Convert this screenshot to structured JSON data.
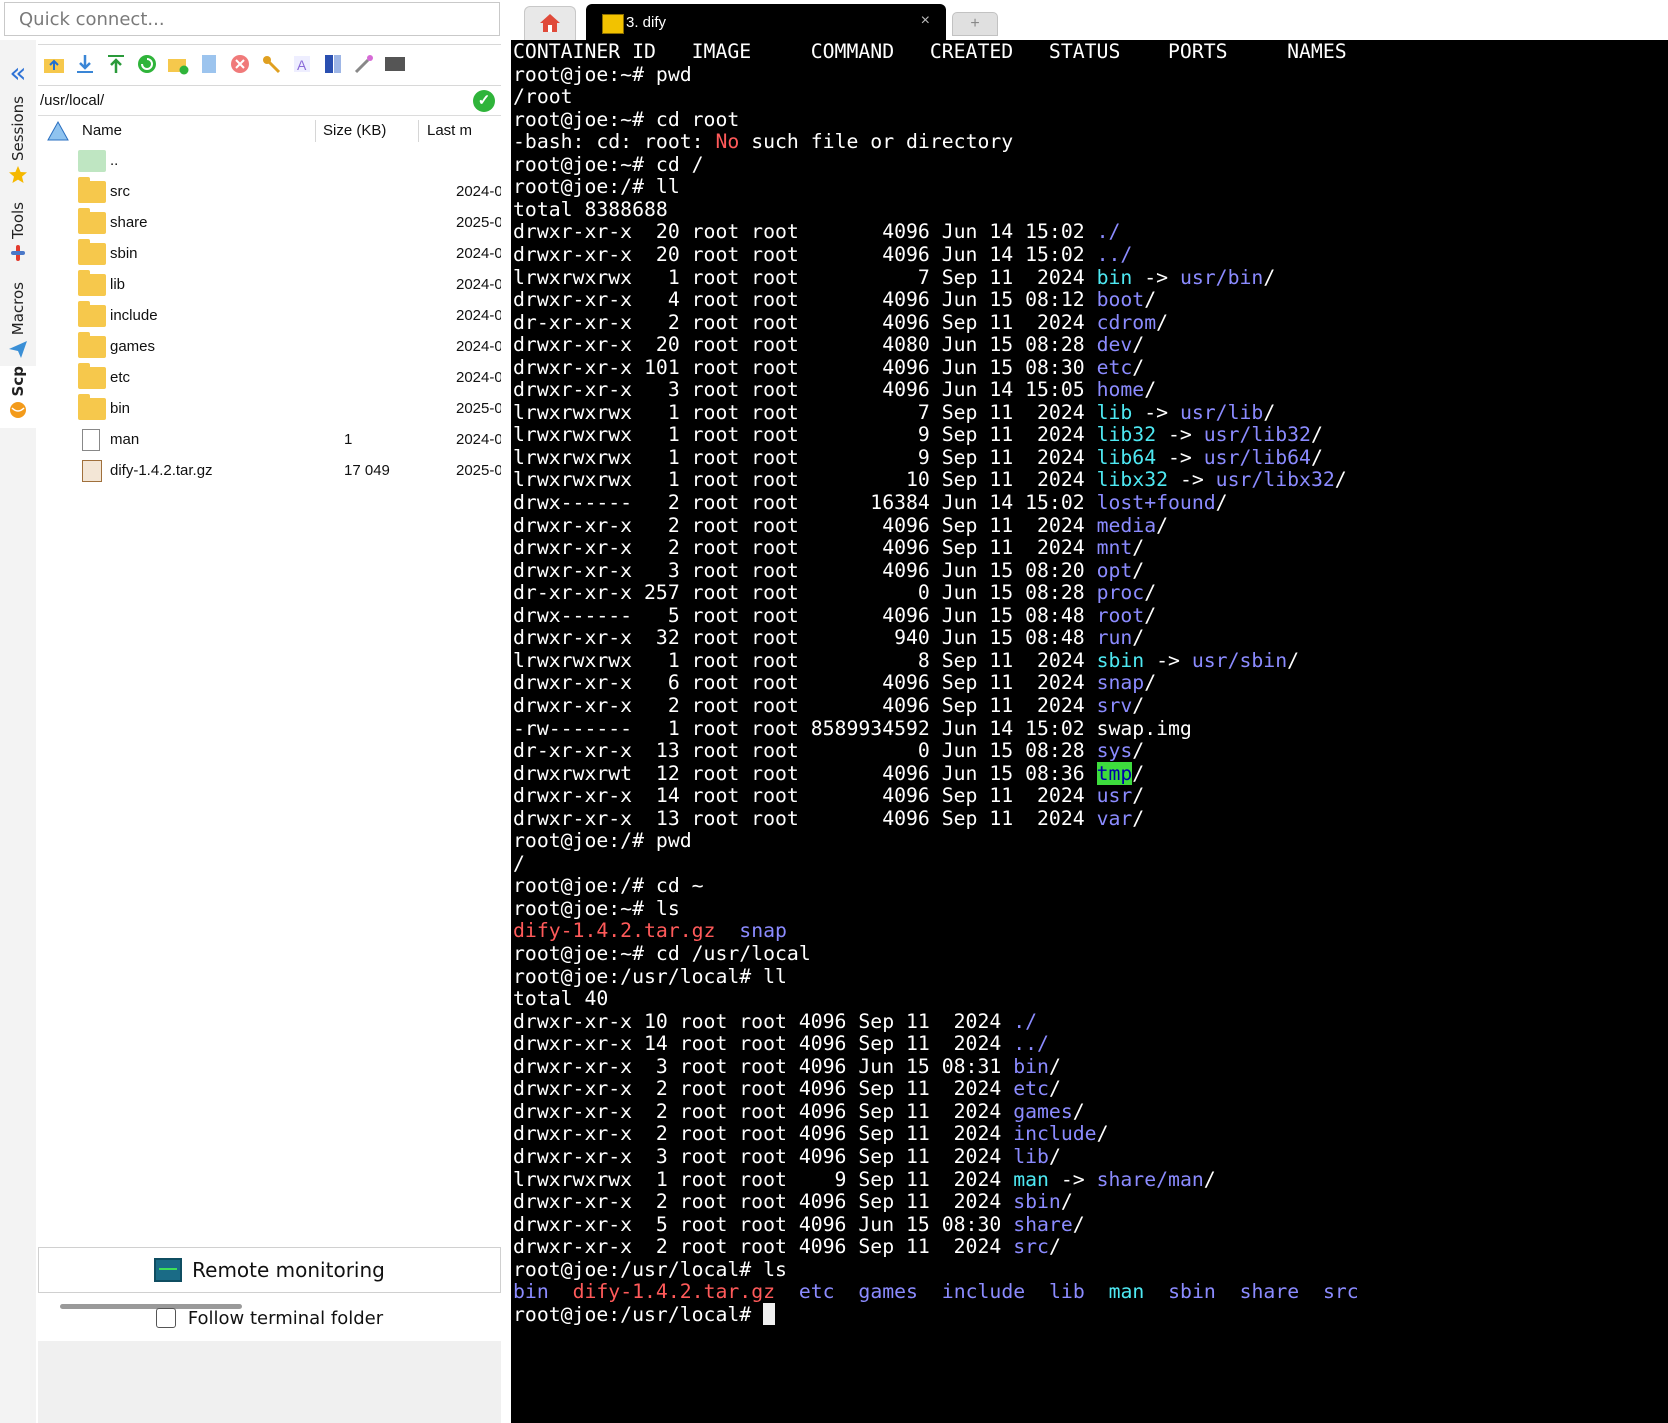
{
  "quick_connect": {
    "placeholder": "Quick connect..."
  },
  "side_tabs": {
    "sessions": "Sessions",
    "tools": "Tools",
    "macros": "Macros",
    "scp": "Scp"
  },
  "browser": {
    "path": "/usr/local/",
    "columns": {
      "name": "Name",
      "size": "Size (KB)",
      "last_modified": "Last m"
    },
    "files": [
      {
        "name": "..",
        "size": "",
        "date": "",
        "kind": "updir"
      },
      {
        "name": "src",
        "size": "",
        "date": "2024-0",
        "kind": "folder"
      },
      {
        "name": "share",
        "size": "",
        "date": "2025-0",
        "kind": "folder"
      },
      {
        "name": "sbin",
        "size": "",
        "date": "2024-0",
        "kind": "folder"
      },
      {
        "name": "lib",
        "size": "",
        "date": "2024-0",
        "kind": "folder"
      },
      {
        "name": "include",
        "size": "",
        "date": "2024-0",
        "kind": "folder"
      },
      {
        "name": "games",
        "size": "",
        "date": "2024-0",
        "kind": "folder"
      },
      {
        "name": "etc",
        "size": "",
        "date": "2024-0",
        "kind": "folder"
      },
      {
        "name": "bin",
        "size": "",
        "date": "2025-0",
        "kind": "folder"
      },
      {
        "name": "man",
        "size": "1",
        "date": "2024-0",
        "kind": "link"
      },
      {
        "name": "dify-1.4.2.tar.gz",
        "size": "17 049",
        "date": "2025-0",
        "kind": "archive"
      }
    ],
    "remote_monitoring": "Remote monitoring",
    "follow_terminal": "Follow terminal folder"
  },
  "tabs": {
    "active_title": "3. dify",
    "close": "×",
    "new": "+"
  },
  "colors": {
    "dir": "#8b8bff",
    "link": "#4ee9f3",
    "error": "#ff5a5a",
    "tmp_bg": "#3ddc3d",
    "folder": "#f6c84c"
  },
  "terminal": {
    "lines": [
      [
        [
          "",
          "CONTAINER ID   IMAGE     COMMAND   CREATED   STATUS    PORTS     NAMES"
        ]
      ],
      [
        [
          "",
          "root@joe:~# pwd"
        ]
      ],
      [
        [
          "",
          "/root"
        ]
      ],
      [
        [
          "",
          "root@joe:~# cd root"
        ]
      ],
      [
        [
          "",
          "-bash: cd: root: "
        ],
        [
          "red",
          "No"
        ],
        [
          "",
          " such file or directory"
        ]
      ],
      [
        [
          "",
          "root@joe:~# cd /"
        ]
      ],
      [
        [
          "",
          "root@joe:/# ll"
        ]
      ],
      [
        [
          "",
          "total 8388688"
        ]
      ],
      [
        [
          "",
          "drwxr-xr-x  20 root root       4096 Jun 14 15:02 "
        ],
        [
          "dir",
          "./"
        ]
      ],
      [
        [
          "",
          "drwxr-xr-x  20 root root       4096 Jun 14 15:02 "
        ],
        [
          "dir",
          "../"
        ]
      ],
      [
        [
          "",
          "lrwxrwxrwx   1 root root          7 Sep 11  2024 "
        ],
        [
          "link",
          "bin"
        ],
        [
          "",
          " -> "
        ],
        [
          "dir",
          "usr/bin"
        ],
        [
          "",
          "/"
        ]
      ],
      [
        [
          "",
          "drwxr-xr-x   4 root root       4096 Jun 15 08:12 "
        ],
        [
          "dir",
          "boot"
        ],
        [
          "",
          "/"
        ]
      ],
      [
        [
          "",
          "dr-xr-xr-x   2 root root       4096 Sep 11  2024 "
        ],
        [
          "dir",
          "cdrom"
        ],
        [
          "",
          "/"
        ]
      ],
      [
        [
          "",
          "drwxr-xr-x  20 root root       4080 Jun 15 08:28 "
        ],
        [
          "dir",
          "dev"
        ],
        [
          "",
          "/"
        ]
      ],
      [
        [
          "",
          "drwxr-xr-x 101 root root       4096 Jun 15 08:30 "
        ],
        [
          "dir",
          "etc"
        ],
        [
          "",
          "/"
        ]
      ],
      [
        [
          "",
          "drwxr-xr-x   3 root root       4096 Jun 14 15:05 "
        ],
        [
          "dir",
          "home"
        ],
        [
          "",
          "/"
        ]
      ],
      [
        [
          "",
          "lrwxrwxrwx   1 root root          7 Sep 11  2024 "
        ],
        [
          "link",
          "lib"
        ],
        [
          "",
          " -> "
        ],
        [
          "dir",
          "usr/lib"
        ],
        [
          "",
          "/"
        ]
      ],
      [
        [
          "",
          "lrwxrwxrwx   1 root root          9 Sep 11  2024 "
        ],
        [
          "link",
          "lib32"
        ],
        [
          "",
          " -> "
        ],
        [
          "dir",
          "usr/lib32"
        ],
        [
          "",
          "/"
        ]
      ],
      [
        [
          "",
          "lrwxrwxrwx   1 root root          9 Sep 11  2024 "
        ],
        [
          "link",
          "lib64"
        ],
        [
          "",
          " -> "
        ],
        [
          "dir",
          "usr/lib64"
        ],
        [
          "",
          "/"
        ]
      ],
      [
        [
          "",
          "lrwxrwxrwx   1 root root         10 Sep 11  2024 "
        ],
        [
          "link",
          "libx32"
        ],
        [
          "",
          " -> "
        ],
        [
          "dir",
          "usr/libx32"
        ],
        [
          "",
          "/"
        ]
      ],
      [
        [
          "",
          "drwx------   2 root root      16384 Jun 14 15:02 "
        ],
        [
          "dir",
          "lost+found"
        ],
        [
          "",
          "/"
        ]
      ],
      [
        [
          "",
          "drwxr-xr-x   2 root root       4096 Sep 11  2024 "
        ],
        [
          "dir",
          "media"
        ],
        [
          "",
          "/"
        ]
      ],
      [
        [
          "",
          "drwxr-xr-x   2 root root       4096 Sep 11  2024 "
        ],
        [
          "dir",
          "mnt"
        ],
        [
          "",
          "/"
        ]
      ],
      [
        [
          "",
          "drwxr-xr-x   3 root root       4096 Jun 15 08:20 "
        ],
        [
          "dir",
          "opt"
        ],
        [
          "",
          "/"
        ]
      ],
      [
        [
          "",
          "dr-xr-xr-x 257 root root          0 Jun 15 08:28 "
        ],
        [
          "dir",
          "proc"
        ],
        [
          "",
          "/"
        ]
      ],
      [
        [
          "",
          "drwx------   5 root root       4096 Jun 15 08:48 "
        ],
        [
          "dir",
          "root"
        ],
        [
          "",
          "/"
        ]
      ],
      [
        [
          "",
          "drwxr-xr-x  32 root root        940 Jun 15 08:48 "
        ],
        [
          "dir",
          "run"
        ],
        [
          "",
          "/"
        ]
      ],
      [
        [
          "",
          "lrwxrwxrwx   1 root root          8 Sep 11  2024 "
        ],
        [
          "link",
          "sbin"
        ],
        [
          "",
          " -> "
        ],
        [
          "dir",
          "usr/sbin"
        ],
        [
          "",
          "/"
        ]
      ],
      [
        [
          "",
          "drwxr-xr-x   6 root root       4096 Sep 11  2024 "
        ],
        [
          "dir",
          "snap"
        ],
        [
          "",
          "/"
        ]
      ],
      [
        [
          "",
          "drwxr-xr-x   2 root root       4096 Sep 11  2024 "
        ],
        [
          "dir",
          "srv"
        ],
        [
          "",
          "/"
        ]
      ],
      [
        [
          "",
          "-rw-------   1 root root 8589934592 Jun 14 15:02 swap.img"
        ]
      ],
      [
        [
          "",
          "dr-xr-xr-x  13 root root          0 Jun 15 08:28 "
        ],
        [
          "dir",
          "sys"
        ],
        [
          "",
          "/"
        ]
      ],
      [
        [
          "",
          "drwxrwxrwt  12 root root       4096 Jun 15 08:36 "
        ],
        [
          "tmp",
          "tmp"
        ],
        [
          "",
          "/"
        ]
      ],
      [
        [
          "",
          "drwxr-xr-x  14 root root       4096 Sep 11  2024 "
        ],
        [
          "dir",
          "usr"
        ],
        [
          "",
          "/"
        ]
      ],
      [
        [
          "",
          "drwxr-xr-x  13 root root       4096 Sep 11  2024 "
        ],
        [
          "dir",
          "var"
        ],
        [
          "",
          "/"
        ]
      ],
      [
        [
          "",
          "root@joe:/# pwd"
        ]
      ],
      [
        [
          "",
          "/"
        ]
      ],
      [
        [
          "",
          "root@joe:/# cd ~"
        ]
      ],
      [
        [
          "",
          "root@joe:~# ls"
        ]
      ],
      [
        [
          "tar",
          "dify-1.4.2.tar.gz"
        ],
        [
          "",
          "  "
        ],
        [
          "dir",
          "snap"
        ]
      ],
      [
        [
          "",
          "root@joe:~# cd /usr/local"
        ]
      ],
      [
        [
          "",
          "root@joe:/usr/local# ll"
        ]
      ],
      [
        [
          "",
          "total 40"
        ]
      ],
      [
        [
          "",
          "drwxr-xr-x 10 root root 4096 Sep 11  2024 "
        ],
        [
          "dir",
          "./"
        ]
      ],
      [
        [
          "",
          "drwxr-xr-x 14 root root 4096 Sep 11  2024 "
        ],
        [
          "dir",
          "../"
        ]
      ],
      [
        [
          "",
          "drwxr-xr-x  3 root root 4096 Jun 15 08:31 "
        ],
        [
          "dir",
          "bin"
        ],
        [
          "",
          "/"
        ]
      ],
      [
        [
          "",
          "drwxr-xr-x  2 root root 4096 Sep 11  2024 "
        ],
        [
          "dir",
          "etc"
        ],
        [
          "",
          "/"
        ]
      ],
      [
        [
          "",
          "drwxr-xr-x  2 root root 4096 Sep 11  2024 "
        ],
        [
          "dir",
          "games"
        ],
        [
          "",
          "/"
        ]
      ],
      [
        [
          "",
          "drwxr-xr-x  2 root root 4096 Sep 11  2024 "
        ],
        [
          "dir",
          "include"
        ],
        [
          "",
          "/"
        ]
      ],
      [
        [
          "",
          "drwxr-xr-x  3 root root 4096 Sep 11  2024 "
        ],
        [
          "dir",
          "lib"
        ],
        [
          "",
          "/"
        ]
      ],
      [
        [
          "",
          "lrwxrwxrwx  1 root root    9 Sep 11  2024 "
        ],
        [
          "link",
          "man"
        ],
        [
          "",
          " -> "
        ],
        [
          "dir",
          "share/man"
        ],
        [
          "",
          "/"
        ]
      ],
      [
        [
          "",
          "drwxr-xr-x  2 root root 4096 Sep 11  2024 "
        ],
        [
          "dir",
          "sbin"
        ],
        [
          "",
          "/"
        ]
      ],
      [
        [
          "",
          "drwxr-xr-x  5 root root 4096 Jun 15 08:30 "
        ],
        [
          "dir",
          "share"
        ],
        [
          "",
          "/"
        ]
      ],
      [
        [
          "",
          "drwxr-xr-x  2 root root 4096 Sep 11  2024 "
        ],
        [
          "dir",
          "src"
        ],
        [
          "",
          "/"
        ]
      ],
      [
        [
          "",
          "root@joe:/usr/local# ls"
        ]
      ],
      [
        [
          "dir",
          "bin"
        ],
        [
          "",
          "  "
        ],
        [
          "tar",
          "dify-1.4.2.tar.gz"
        ],
        [
          "",
          "  "
        ],
        [
          "dir",
          "etc"
        ],
        [
          "",
          "  "
        ],
        [
          "dir",
          "games"
        ],
        [
          "",
          "  "
        ],
        [
          "dir",
          "include"
        ],
        [
          "",
          "  "
        ],
        [
          "dir",
          "lib"
        ],
        [
          "",
          "  "
        ],
        [
          "link",
          "man"
        ],
        [
          "",
          "  "
        ],
        [
          "dir",
          "sbin"
        ],
        [
          "",
          "  "
        ],
        [
          "dir",
          "share"
        ],
        [
          "",
          "  "
        ],
        [
          "dir",
          "src"
        ]
      ],
      [
        [
          "",
          "root@joe:/usr/local# "
        ],
        [
          "cursor",
          ""
        ]
      ]
    ]
  }
}
